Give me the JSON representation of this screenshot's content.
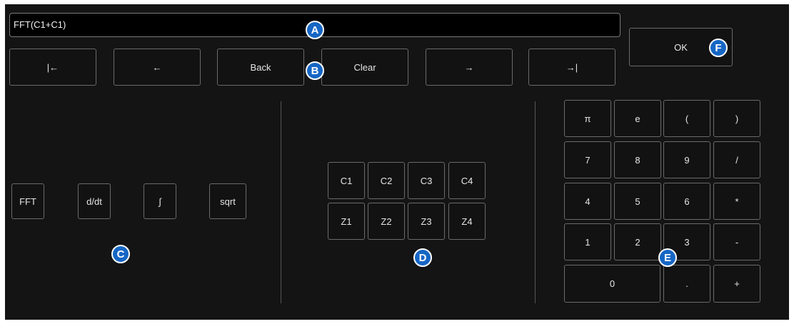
{
  "expression": {
    "value": "FFT(C1+C1)"
  },
  "edit_buttons": {
    "home": "|←",
    "left": "←",
    "back": "Back",
    "clear": "Clear",
    "right": "→",
    "end": "→|"
  },
  "ok_button": "OK",
  "functions": [
    "FFT",
    "d/dt",
    "∫",
    "sqrt"
  ],
  "sources": {
    "row1": [
      "C1",
      "C2",
      "C3",
      "C4"
    ],
    "row2": [
      "Z1",
      "Z2",
      "Z3",
      "Z4"
    ]
  },
  "keypad": {
    "row1": [
      "π",
      "e",
      "(",
      ")"
    ],
    "row2": [
      "7",
      "8",
      "9",
      "/"
    ],
    "row3": [
      "4",
      "5",
      "6",
      "*"
    ],
    "row4": [
      "1",
      "2",
      "3",
      "-"
    ],
    "row5": [
      "0",
      ".",
      "+"
    ]
  },
  "callouts": {
    "a": "A",
    "b": "B",
    "c": "C",
    "d": "D",
    "e": "E",
    "f": "F"
  },
  "colors": {
    "badge": "#1666c4",
    "background": "#141414",
    "border": "#6a6a6a"
  }
}
